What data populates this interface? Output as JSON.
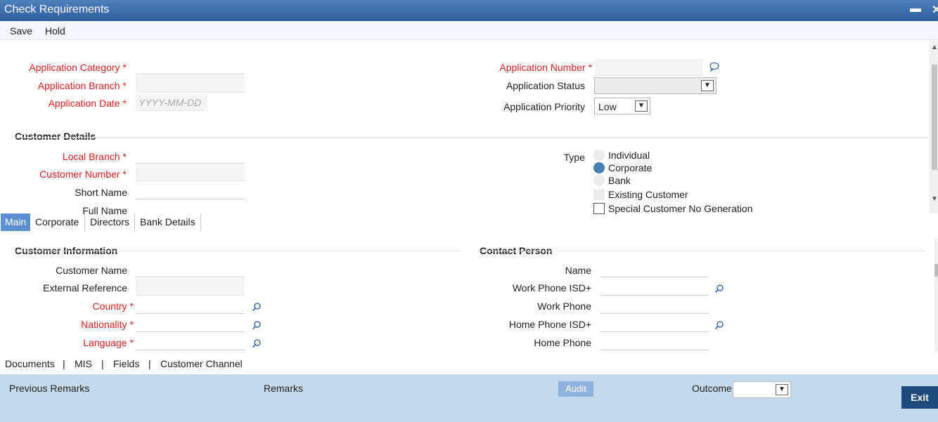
{
  "window": {
    "title": "Check Requirements",
    "minimize_glyph": "▬",
    "close_glyph": "✕"
  },
  "menu": {
    "save": "Save",
    "hold": "Hold"
  },
  "header": {
    "application_category_label": "Application Category",
    "application_branch_label": "Application Branch",
    "application_date_label": "Application Date",
    "application_date_placeholder": "YYYY-MM-DD",
    "application_number_label": "Application Number",
    "application_status_label": "Application Status",
    "application_priority_label": "Application Priority",
    "application_priority_value": "Low",
    "required_mark": "*"
  },
  "customer_details": {
    "title": "Customer Details",
    "local_branch_label": "Local Branch",
    "customer_number_label": "Customer Number",
    "short_name_label": "Short Name",
    "full_name_label": "Full Name",
    "type_label": "Type",
    "type_options": [
      "Individual",
      "Corporate",
      "Bank"
    ],
    "selected_type": "Corporate",
    "existing_customer_label": "Existing Customer",
    "special_customer_label": "Special Customer No Generation"
  },
  "tabs": [
    "Main",
    "Corporate",
    "Directors",
    "Bank Details"
  ],
  "active_tab": "Main",
  "customer_information": {
    "title": "Customer Information",
    "customer_name_label": "Customer Name",
    "external_reference_label": "External Reference",
    "country_label": "Country",
    "nationality_label": "Nationality",
    "language_label": "Language"
  },
  "contact_person": {
    "title": "Contact Person",
    "name_label": "Name",
    "work_phone_isd_label": "Work Phone ISD+",
    "work_phone_label": "Work Phone",
    "home_phone_isd_label": "Home Phone ISD+",
    "home_phone_label": "Home Phone"
  },
  "links": {
    "documents": "Documents",
    "mis": "MIS",
    "fields": "Fields",
    "customer_channel": "Customer Channel",
    "separator": "|"
  },
  "footer": {
    "previous_remarks": "Previous Remarks",
    "remarks": "Remarks",
    "audit": "Audit",
    "outcome_label": "Outcome",
    "exit": "Exit"
  },
  "colors": {
    "required": "#dd2222",
    "accent": "#5b8fd1",
    "footer_bg": "#c3d9ec",
    "exit_bg": "#1f4a7c"
  },
  "icons": {
    "lookup": "search-icon",
    "remarks": "speech-bubble-icon",
    "dropdown": "chevron-down-icon"
  }
}
